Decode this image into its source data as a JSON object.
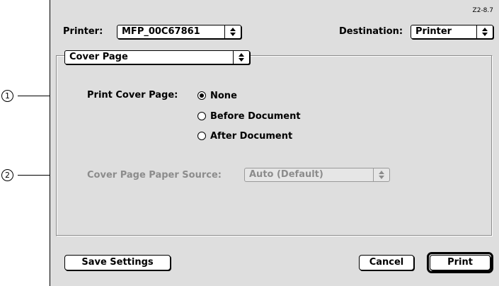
{
  "callouts": [
    "1",
    "2"
  ],
  "dialog": {
    "version": "Z2-8.7",
    "printer_label": "Printer:",
    "printer_value": "MFP_00C67861",
    "destination_label": "Destination:",
    "destination_value": "Printer",
    "panel_value": "Cover Page",
    "cover_page": {
      "label": "Print Cover Page:",
      "options": [
        "None",
        "Before Document",
        "After Document"
      ],
      "selected": "None"
    },
    "paper_source": {
      "label": "Cover Page Paper Source:",
      "value": "Auto (Default)"
    },
    "buttons": {
      "save": "Save Settings",
      "cancel": "Cancel",
      "print": "Print"
    }
  }
}
